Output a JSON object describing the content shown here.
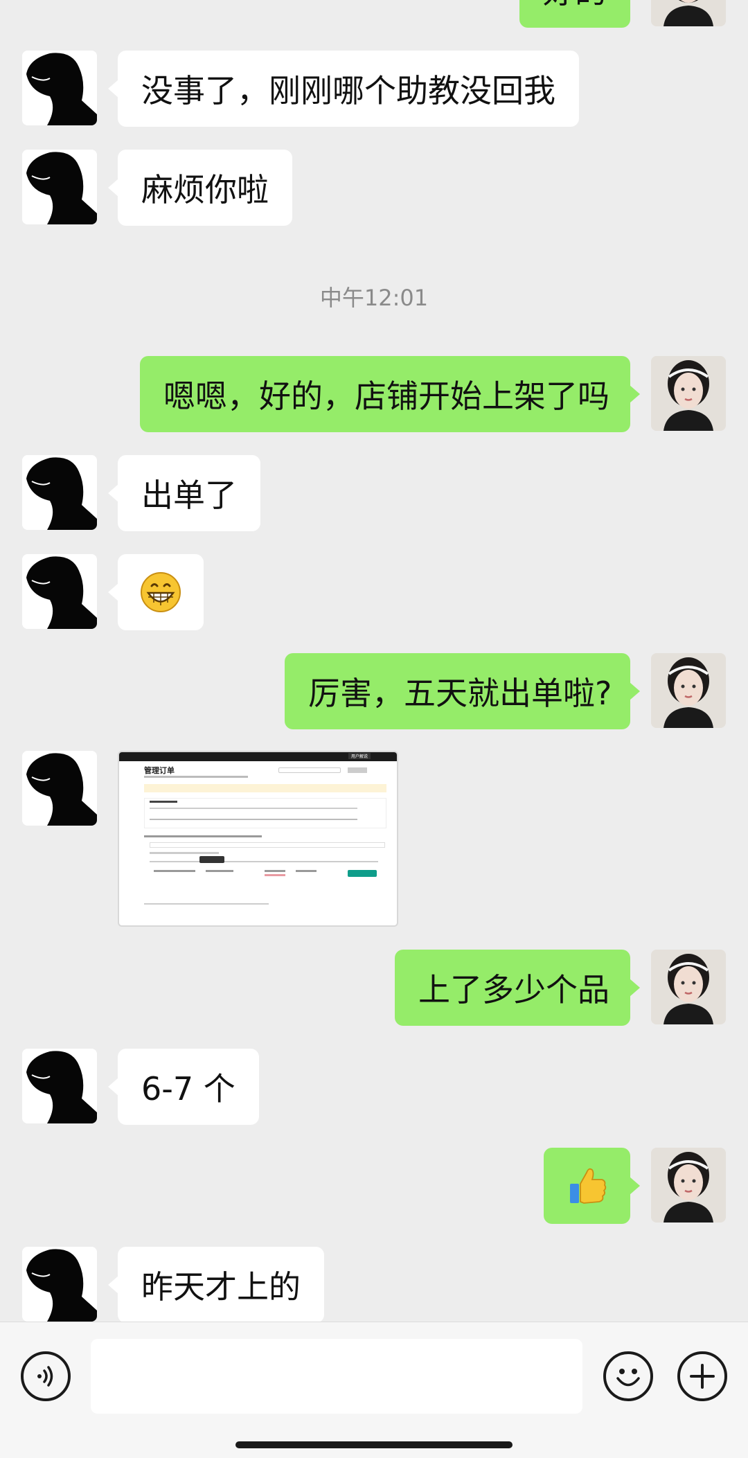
{
  "timestamp": "中午12:01",
  "messages": [
    {
      "side": "out",
      "text": "好的"
    },
    {
      "side": "in",
      "text": "没事了，刚刚哪个助教没回我"
    },
    {
      "side": "in",
      "text": "麻烦你啦"
    },
    {
      "side": "out",
      "text": "嗯嗯，好的，店铺开始上架了吗"
    },
    {
      "side": "in",
      "text": "出单了"
    },
    {
      "side": "in",
      "emoji": "grinning-face"
    },
    {
      "side": "out",
      "text": "厉害，五天就出单啦?"
    },
    {
      "side": "in",
      "image": "order-management-screenshot"
    },
    {
      "side": "out",
      "text": "上了多少个品"
    },
    {
      "side": "in",
      "text": "6-7 个"
    },
    {
      "side": "out",
      "emoji": "thumbs-up"
    },
    {
      "side": "in",
      "text": "昨天才上的"
    }
  ],
  "screenshot": {
    "title": "管理订单",
    "badge_text": "用户解说"
  },
  "input": {
    "value": "",
    "voice_icon": "voice-icon",
    "emoji_icon": "emoji-icon",
    "plus_icon": "plus-icon"
  },
  "colors": {
    "background": "#ededed",
    "incoming_bubble": "#ffffff",
    "outgoing_bubble": "#95ec69"
  }
}
